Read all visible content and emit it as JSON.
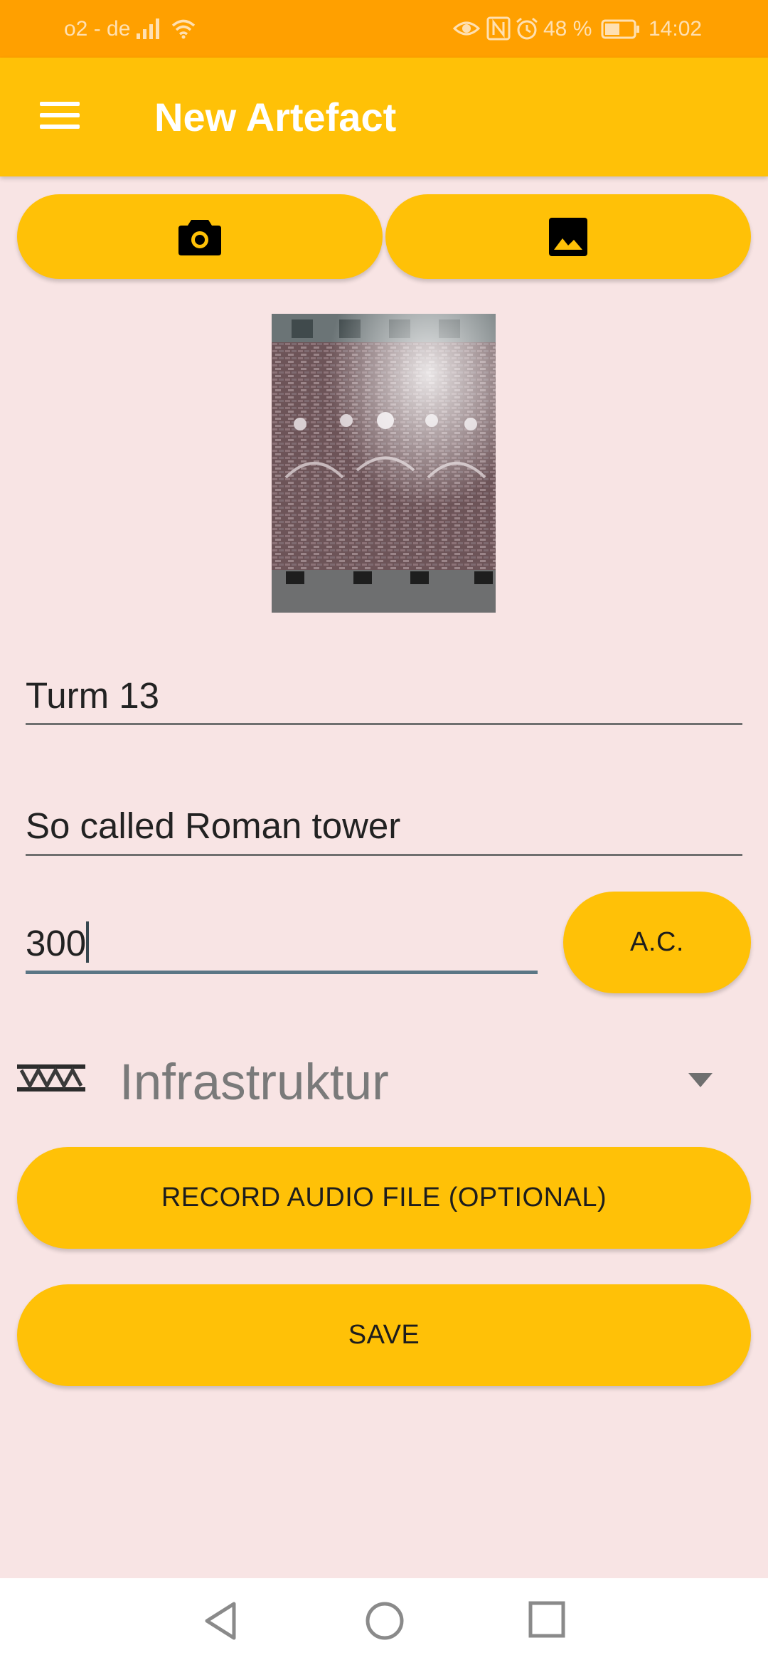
{
  "status_bar": {
    "carrier": "o2 - de",
    "battery": "48 %",
    "time": "14:02",
    "icons": [
      "signal-icon",
      "wifi-icon",
      "eye-icon",
      "nfc-icon",
      "alarm-icon",
      "battery-icon"
    ]
  },
  "app_bar": {
    "title": "New Artefact",
    "menu_icon": "menu-icon"
  },
  "media_buttons": {
    "camera_icon": "camera-icon",
    "gallery_icon": "image-icon"
  },
  "photo": {
    "subject": "photo of Roman tower"
  },
  "form": {
    "name": "Turm 13",
    "description": "So called Roman tower",
    "year": "300",
    "era_label": "A.C.",
    "category": "Infrastruktur",
    "record_label": "RECORD AUDIO FILE (OPTIONAL)",
    "save_label": "SAVE"
  },
  "colors": {
    "status_bar": "#FFA000",
    "primary": "#FFC107",
    "background": "#F8E4E4",
    "underline_active": "#5B7685"
  },
  "nav_bar": {
    "icons": [
      "back-icon",
      "home-icon",
      "recents-icon"
    ]
  }
}
